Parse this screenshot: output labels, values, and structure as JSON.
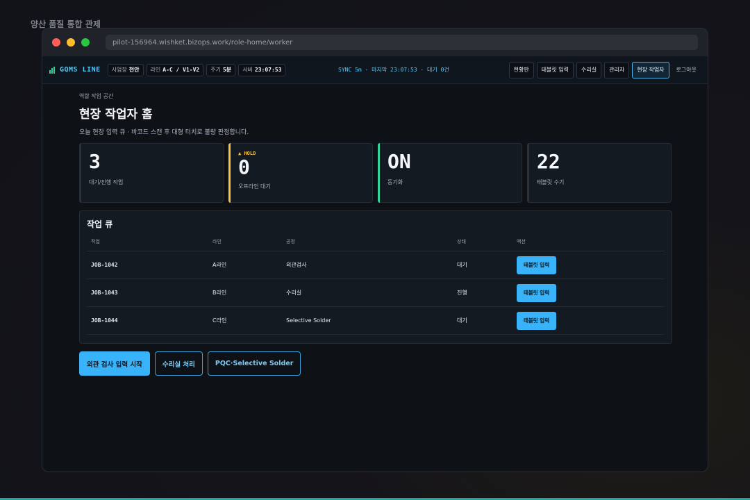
{
  "page_label": "양산 품질 통합 관제",
  "browser": {
    "url": "pilot-156964.wishket.bizops.work/role-home/worker"
  },
  "appbar": {
    "brand": "GQMS LINE",
    "chips": [
      {
        "label": "사업장",
        "value": "천안"
      },
      {
        "label": "라인",
        "value": "A-C / V1-V2"
      },
      {
        "label": "주기",
        "value": "5분"
      },
      {
        "label": "서버",
        "value": "23:07:53"
      }
    ],
    "sync_status": "SYNC 5m · 마지막 23:07:53 · 대기 0건",
    "nav": [
      {
        "label": "현황판",
        "active": false
      },
      {
        "label": "태블릿 입력",
        "active": false
      },
      {
        "label": "수리실",
        "active": false
      },
      {
        "label": "관리자",
        "active": false
      },
      {
        "label": "현장 작업자",
        "active": true
      }
    ],
    "logout": "로그아웃"
  },
  "main": {
    "eyebrow": "역할 작업 공간",
    "title": "현장 작업자 홈",
    "subtitle": "오늘 현장 입력 큐 · 바코드 스캔 후 대형 터치로 불량 판정합니다.",
    "stats": [
      {
        "badge": "",
        "value": "3",
        "label": "대기/진행 작업"
      },
      {
        "badge": "▲ HOLD",
        "value": "0",
        "label": "오프라인 대기"
      },
      {
        "badge": "",
        "value": "ON",
        "label": "동기화"
      },
      {
        "badge": "",
        "value": "22",
        "label": "태블릿 수기"
      }
    ],
    "queue": {
      "title": "작업 큐",
      "columns": [
        "작업",
        "라인",
        "공정",
        "상태",
        "액션"
      ],
      "rows": [
        {
          "job": "JOB-1042",
          "line": "A라인",
          "process": "외관검사",
          "status": "대기",
          "action": "태블릿 입력"
        },
        {
          "job": "JOB-1043",
          "line": "B라인",
          "process": "수리실",
          "status": "진행",
          "action": "태블릿 입력"
        },
        {
          "job": "JOB-1044",
          "line": "C라인",
          "process": "Selective Solder",
          "status": "대기",
          "action": "태블릿 입력"
        }
      ]
    },
    "actions": [
      {
        "label": "외관 검사 입력 시작",
        "style": "primary"
      },
      {
        "label": "수리실 처리",
        "style": "outline"
      },
      {
        "label": "PQC·Selective Solder",
        "style": "outline"
      }
    ]
  },
  "colors": {
    "accent": "#38b2f8",
    "hold": "#f5c542",
    "ok": "#34d399",
    "background": "#0e1217"
  }
}
